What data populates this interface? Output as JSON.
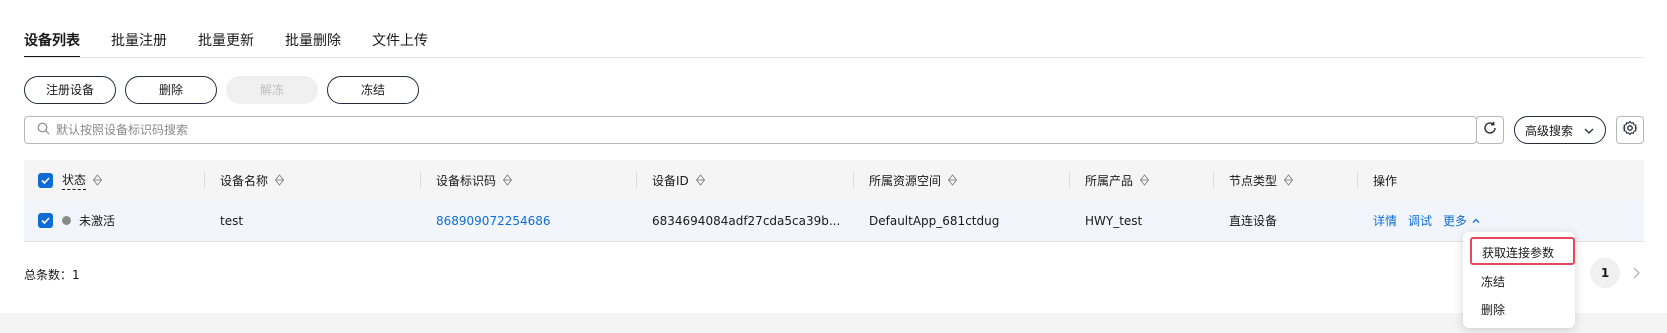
{
  "tabs": [
    {
      "label": "设备列表",
      "active": true
    },
    {
      "label": "批量注册",
      "active": false
    },
    {
      "label": "批量更新",
      "active": false
    },
    {
      "label": "批量删除",
      "active": false
    },
    {
      "label": "文件上传",
      "active": false
    }
  ],
  "toolbar": {
    "register_label": "注册设备",
    "delete_label": "删除",
    "unfreeze_label": "解冻",
    "freeze_label": "冻结"
  },
  "search": {
    "placeholder": "默认按照设备标识码搜索",
    "advanced_label": "高级搜索"
  },
  "table": {
    "headers": {
      "status": "状态",
      "name": "设备名称",
      "identifier": "设备标识码",
      "device_id": "设备ID",
      "space": "所属资源空间",
      "product": "所属产品",
      "node_type": "节点类型",
      "actions": "操作"
    },
    "rows": [
      {
        "status": "未激活",
        "name": "test",
        "identifier": "868909072254686",
        "device_id": "6834694084adf27cda5ca39b...",
        "space": "DefaultApp_681ctdug",
        "product": "HWY_test",
        "node_type": "直连设备",
        "actions": {
          "detail": "详情",
          "debug": "调试",
          "more": "更多"
        }
      }
    ]
  },
  "footer": {
    "total": "总条数：1",
    "page": "1"
  },
  "dropdown": {
    "items": [
      "获取连接参数",
      "冻结",
      "删除"
    ]
  },
  "colors": {
    "primary": "#0f6cd6",
    "highlight": "#e5485a",
    "row_hover": "#f2f6fc",
    "status_inactive": "#8a8a8a"
  }
}
